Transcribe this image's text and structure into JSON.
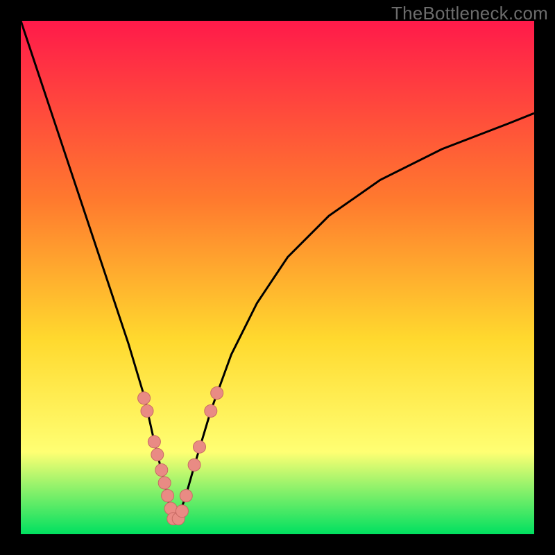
{
  "watermark": "TheBottleneck.com",
  "colors": {
    "bg": "#000000",
    "gradient_top": "#ff1a4a",
    "gradient_mid1": "#ff7a2e",
    "gradient_mid2": "#ffd92e",
    "gradient_mid3": "#ffff73",
    "gradient_bottom": "#00e060",
    "curve": "#000000",
    "dot_fill": "#e98b84",
    "dot_stroke": "#c86a64"
  },
  "chart_data": {
    "type": "line",
    "title": "",
    "xlabel": "",
    "ylabel": "",
    "xlim": [
      0,
      100
    ],
    "ylim": [
      0,
      100
    ],
    "series": [
      {
        "name": "bottleneck-curve",
        "x": [
          0,
          3,
          6,
          9,
          12,
          15,
          18,
          21,
          24,
          26,
          28,
          29.5,
          30.5,
          32,
          34,
          37,
          41,
          46,
          52,
          60,
          70,
          82,
          95,
          100
        ],
        "y": [
          100,
          91,
          82,
          73,
          64,
          55,
          46,
          37,
          27,
          18,
          10,
          3,
          3,
          7,
          14,
          24,
          35,
          45,
          54,
          62,
          69,
          75,
          80,
          82
        ]
      }
    ],
    "dots": {
      "name": "highlight-dots",
      "points": [
        {
          "x": 24.0,
          "y": 26.5
        },
        {
          "x": 24.6,
          "y": 24.0
        },
        {
          "x": 26.0,
          "y": 18.0
        },
        {
          "x": 26.6,
          "y": 15.5
        },
        {
          "x": 27.4,
          "y": 12.5
        },
        {
          "x": 28.0,
          "y": 10.0
        },
        {
          "x": 28.6,
          "y": 7.5
        },
        {
          "x": 29.2,
          "y": 5.0
        },
        {
          "x": 29.7,
          "y": 3.0
        },
        {
          "x": 30.7,
          "y": 3.0
        },
        {
          "x": 31.4,
          "y": 4.5
        },
        {
          "x": 32.2,
          "y": 7.5
        },
        {
          "x": 33.8,
          "y": 13.5
        },
        {
          "x": 34.8,
          "y": 17.0
        },
        {
          "x": 37.0,
          "y": 24.0
        },
        {
          "x": 38.2,
          "y": 27.5
        }
      ]
    }
  }
}
